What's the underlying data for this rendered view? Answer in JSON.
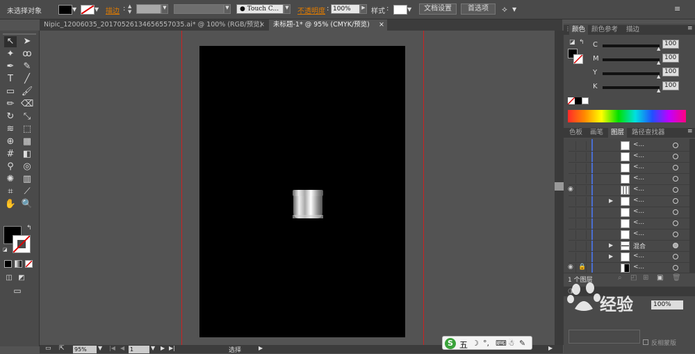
{
  "control": {
    "selection": "未选择对象",
    "stroke_label": "描边",
    "brush": "Touch C...",
    "opacity_label": "不透明度",
    "opacity": "100%",
    "style_label": "样式",
    "doc_setup": "文档设置",
    "prefs": "首选项"
  },
  "tabs": [
    {
      "label": "Nipic_12006035_20170526134656557035.ai* @ 100% (RGB/预览)"
    },
    {
      "label": "未标题-1* @ 95% (CMYK/预览)"
    }
  ],
  "color_panel": {
    "tabs": [
      "颜色",
      "颜色参考",
      "描边"
    ],
    "channels": [
      {
        "name": "C",
        "value": "100"
      },
      {
        "name": "M",
        "value": "100"
      },
      {
        "name": "Y",
        "value": "100"
      },
      {
        "name": "K",
        "value": "100"
      }
    ]
  },
  "layers_panel": {
    "tabs": [
      "色板",
      "画笔",
      "图层",
      "路径查找器"
    ],
    "rows": [
      {
        "name": "<...",
        "eye": false,
        "expand": false
      },
      {
        "name": "<...",
        "eye": false,
        "expand": false
      },
      {
        "name": "<...",
        "eye": false,
        "expand": false
      },
      {
        "name": "<...",
        "eye": false,
        "expand": false
      },
      {
        "name": "<...",
        "eye": true,
        "expand": false
      },
      {
        "name": "<...",
        "eye": false,
        "expand": true
      },
      {
        "name": "<...",
        "eye": false,
        "expand": false
      },
      {
        "name": "<...",
        "eye": false,
        "expand": false
      },
      {
        "name": "<...",
        "eye": false,
        "expand": false
      },
      {
        "name": "混合",
        "eye": false,
        "expand": true
      },
      {
        "name": "<...",
        "eye": false,
        "expand": true
      },
      {
        "name": "<...",
        "eye": true,
        "expand": false
      }
    ],
    "footer": "1 个图层"
  },
  "transparency_panel": {
    "opacity": "100%",
    "invert_mask": "反相蒙版"
  },
  "watermark": "经验",
  "status": {
    "zoom": "95%",
    "page": "1",
    "tool": "选择"
  },
  "ime": {
    "label": "五"
  },
  "colors": {
    "accent": "#e07b00",
    "guide": "#cc2222",
    "artboard": "#000000"
  }
}
